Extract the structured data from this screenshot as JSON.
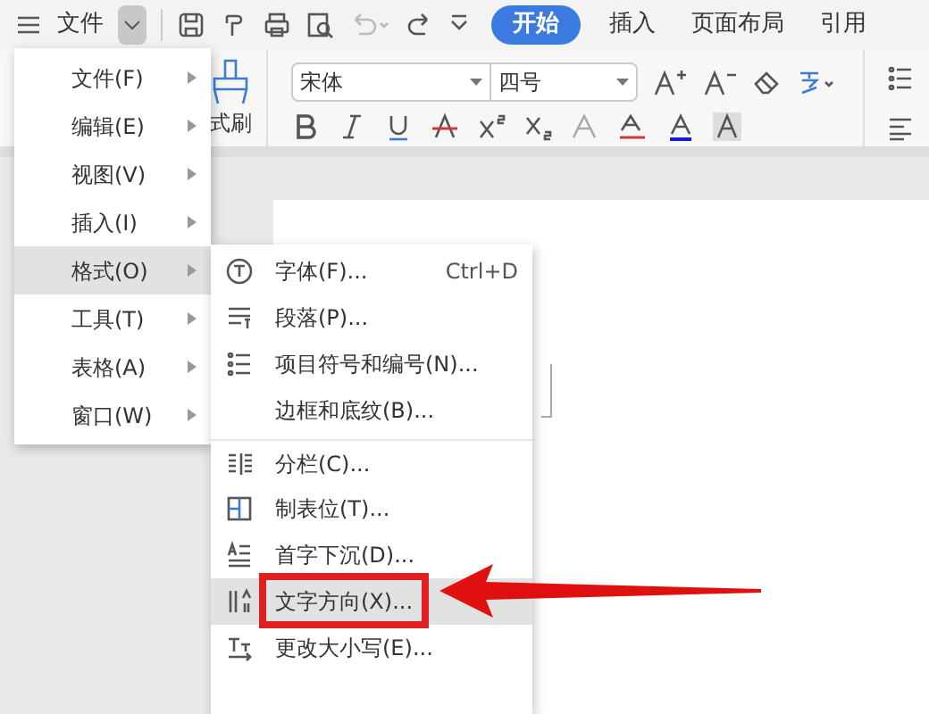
{
  "menu_button": {
    "label": "文件"
  },
  "tabs": [
    {
      "label": "开始",
      "selected": true
    },
    {
      "label": "插入",
      "selected": false
    },
    {
      "label": "页面布局",
      "selected": false
    },
    {
      "label": "引用",
      "selected": false
    }
  ],
  "ribbon": {
    "format_painter_label": "式刷",
    "font_name": "宋体",
    "font_size": "四号"
  },
  "main_menu": [
    {
      "label": "文件(F)",
      "selected": false
    },
    {
      "label": "编辑(E)",
      "selected": false
    },
    {
      "label": "视图(V)",
      "selected": false
    },
    {
      "label": "插入(I)",
      "selected": false
    },
    {
      "label": "格式(O)",
      "selected": true
    },
    {
      "label": "工具(T)",
      "selected": false
    },
    {
      "label": "表格(A)",
      "selected": false
    },
    {
      "label": "窗口(W)",
      "selected": false
    }
  ],
  "format_submenu": [
    {
      "label": "字体(F)...",
      "shortcut": "Ctrl+D",
      "selected": false,
      "divider_before": false,
      "has_submenu": false
    },
    {
      "label": "段落(P)...",
      "selected": false,
      "divider_before": false,
      "has_submenu": false
    },
    {
      "label": "项目符号和编号(N)...",
      "selected": false,
      "divider_before": false,
      "has_submenu": false
    },
    {
      "label": "边框和底纹(B)...",
      "selected": false,
      "divider_before": false,
      "has_submenu": false
    },
    {
      "label": "分栏(C)...",
      "selected": false,
      "divider_before": true,
      "has_submenu": false
    },
    {
      "label": "制表位(T)...",
      "selected": false,
      "divider_before": false,
      "has_submenu": false
    },
    {
      "label": "首字下沉(D)...",
      "selected": false,
      "divider_before": false,
      "has_submenu": false
    },
    {
      "label": "文字方向(X)...",
      "selected": true,
      "divider_before": false,
      "has_submenu": false
    },
    {
      "label": "更改大小写(E)...",
      "selected": false,
      "divider_before": false,
      "has_submenu": false
    }
  ]
}
